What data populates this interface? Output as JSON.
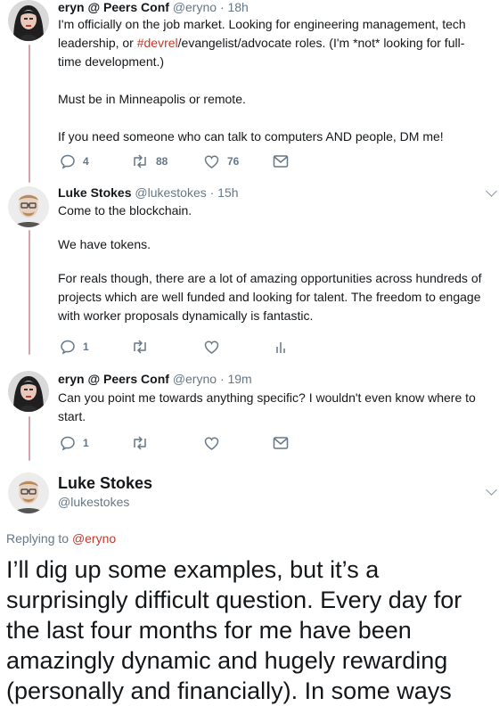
{
  "tweets": [
    {
      "name": "eryn @ Peers Conf",
      "handle": "@eryno",
      "time": "· 18h",
      "text_parts": {
        "p1_a": "I'm officially on the job market. Looking for engineering management, tech leadership, or ",
        "p1_link": "#devrel",
        "p1_b": "/evangelist/advocate roles. (I'm *not* looking for full-time development.)",
        "p2": "Must be in Minneapolis or remote.",
        "p3": "If you need someone who can talk to computers AND people, DM me!"
      },
      "replies": "4",
      "retweets": "88",
      "likes": "76"
    },
    {
      "name": "Luke Stokes",
      "handle": "@lukestokes",
      "time": "· 15h",
      "p1": "Come to the blockchain.",
      "p2": "We have tokens.",
      "p3": "For reals though, there are a lot of amazing opportunities across hundreds of projects which are well funded and looking for talent. The freedom to engage with worker proposals dynamically is fantastic.",
      "replies": "1"
    },
    {
      "name": "eryn @ Peers Conf",
      "handle": "@eryno",
      "time": "· 19m",
      "p1": "Can you point me towards anything specific? I wouldn't even know where to start.",
      "replies": "1"
    }
  ],
  "focused": {
    "name": "Luke Stokes",
    "handle": "@lukestokes",
    "replying_label": "Replying to ",
    "replying_handle": "@eryno",
    "text": "I’ll dig up some examples, but it’s a surprisingly difficult question. Every day for the last four months for me have been amazingly dynamic and hugely rewarding (personally and financially). In some ways"
  },
  "colors": {
    "thread_line": "#d7a5a9",
    "link": "#c0392b",
    "muted": "#657786"
  },
  "icons": [
    "reply-icon",
    "retweet-icon",
    "like-icon",
    "dm-icon",
    "analytics-icon",
    "chevron-down-icon"
  ]
}
